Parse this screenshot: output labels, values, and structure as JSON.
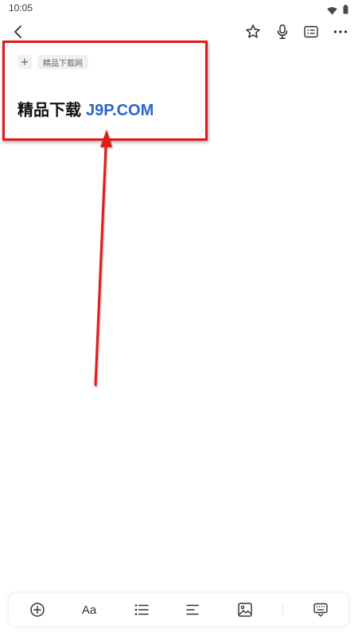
{
  "status_bar": {
    "time": "10:05",
    "wifi_icon": "wifi-icon",
    "battery_icon": "battery-icon"
  },
  "top_bar": {
    "back_icon": "chevron-left-icon",
    "star_icon": "star-icon",
    "mic_icon": "microphone-icon",
    "outline_icon": "outline-list-icon",
    "more_icon": "more-horizontal-icon"
  },
  "note": {
    "add_tag_symbol": "+",
    "tag_label": "精品下载网",
    "title_text": "精品下载",
    "title_brand": "J9P.COM"
  },
  "bottom_toolbar": {
    "add_icon": "circle-plus-icon",
    "font_label": "Aa",
    "list_icon": "bullet-list-icon",
    "align_icon": "align-left-icon",
    "image_icon": "image-icon",
    "keyboard_icon": "keyboard-hide-icon"
  },
  "colors": {
    "annotation_red": "#e01b1b",
    "brand_blue": "#2a66c9"
  }
}
